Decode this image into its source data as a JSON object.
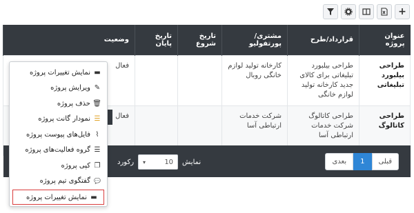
{
  "toolbar": {
    "icons": [
      "plus-icon",
      "excel-icon",
      "columns-icon",
      "gear-icon",
      "filter-icon"
    ],
    "plus_glyph": "+"
  },
  "table": {
    "headers": [
      "عنوان پروژه",
      "قرارداد/طرح",
      "مشتری/پورتفولیو",
      "تاریخ شروع",
      "تاریخ پایان",
      "وضعیت"
    ],
    "rows": [
      {
        "title": "طراحی بیلبورد تبلیغاتی",
        "contract": "طراحی بیلبورد تبلیغاتی برای کالای جدید کارخانه تولید لوازم خانگی",
        "client": "کارخانه تولید لوازم خانگی روبال",
        "start": "",
        "end": "",
        "status": "فعال"
      },
      {
        "title": "طراحی کاتالوگ",
        "contract": "طراحی کاتالوگ شرکت خدمات ارتباطی آسا",
        "client": "شرکت خدمات ارتباطی آسا",
        "start": "",
        "end": "",
        "status": "فعال"
      }
    ]
  },
  "footer": {
    "pagination": {
      "prev": "قبلی",
      "current": "1",
      "next": "بعدی"
    },
    "show_label": "نمایش",
    "page_size": "10",
    "records_label": "رکورد"
  },
  "context_menu": {
    "items": [
      {
        "icon": "archive-icon",
        "glyph": "▬",
        "label": "نمایش تغییرات پروژه"
      },
      {
        "icon": "edit-icon",
        "glyph": "✎",
        "label": "ویرایش پروژه"
      },
      {
        "icon": "trash-icon",
        "glyph": "🗑",
        "label": "حذف پروژه"
      },
      {
        "icon": "gantt-icon",
        "glyph": "☰",
        "label": "نمودار گانت پروژه"
      },
      {
        "icon": "paperclip-icon",
        "glyph": "⌇",
        "label": "فایل‌های پیوست پروژه"
      },
      {
        "icon": "list-icon",
        "glyph": "☰",
        "label": "گروه فعالیت‌های پروژه"
      },
      {
        "icon": "copy-icon",
        "glyph": "❐",
        "label": "کپی پروژه"
      },
      {
        "icon": "chat-icon",
        "glyph": "💬",
        "label": "گفتگوی تیم پروژه"
      },
      {
        "icon": "archive-icon",
        "glyph": "▬",
        "label": "نمایش تغییرات پروژه"
      }
    ]
  }
}
